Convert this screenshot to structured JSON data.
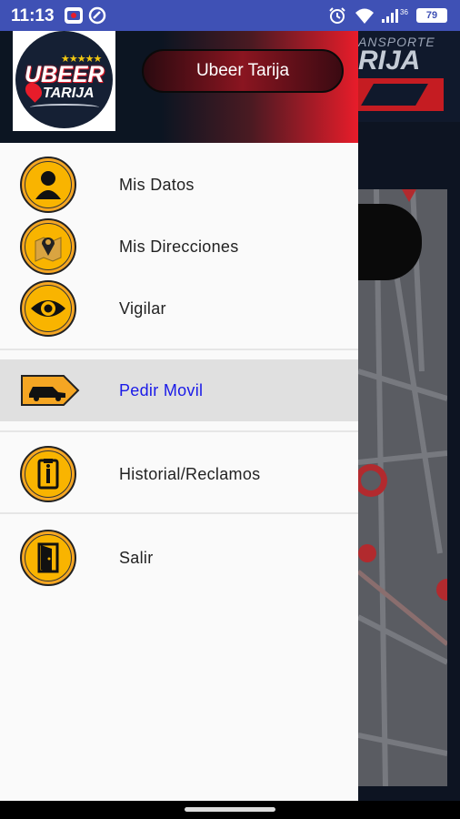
{
  "status_bar": {
    "time": "11:13",
    "battery": "79",
    "left_icons": [
      "app-icon",
      "circle-icon"
    ],
    "right_icons": [
      "alarm-icon",
      "wifi-icon",
      "signal-icon",
      "battery-icon"
    ]
  },
  "header": {
    "logo_text_main": "UBEER",
    "logo_text_sub": "TARIJA",
    "logo_stars": "★★★★★",
    "user_button": "Ubeer Tarija"
  },
  "background_app": {
    "banner_line1": "ANSPORTE",
    "banner_line2": "RIJA"
  },
  "menu": {
    "items": [
      {
        "label": "Mis Datos",
        "icon": "person-icon"
      },
      {
        "label": "Mis Direcciones",
        "icon": "map-pin-icon"
      },
      {
        "label": "Vigilar",
        "icon": "eye-icon"
      },
      {
        "label": "Pedir Movil",
        "icon": "taxi-icon",
        "active": true
      },
      {
        "label": "Historial/Reclamos",
        "icon": "clipboard-icon"
      },
      {
        "label": "Salir",
        "icon": "door-exit-icon"
      }
    ]
  },
  "colors": {
    "status_bar": "#3f51b5",
    "icon_orange": "#f9b400",
    "active_text": "#1a1ae8",
    "active_bg": "#e0e0e0",
    "header_red": "#e81c2a"
  }
}
